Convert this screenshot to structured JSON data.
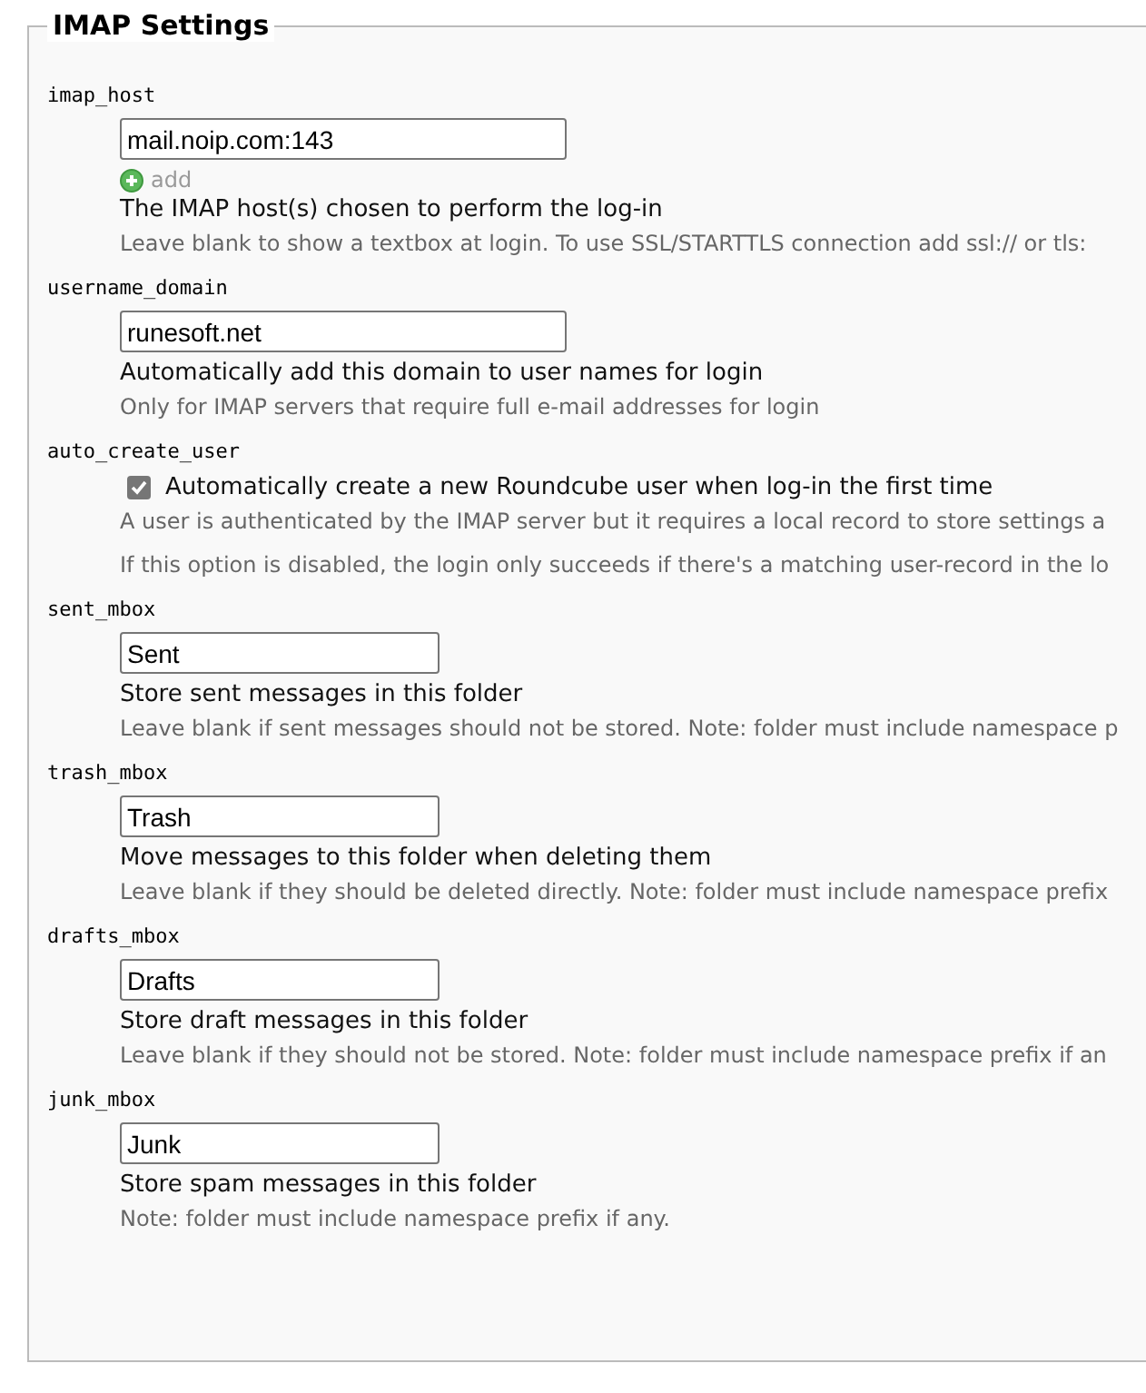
{
  "legend": "IMAP Settings",
  "settings": [
    {
      "name": "imap_host",
      "kind": "text",
      "value": "mail.noip.com:143",
      "wide": true,
      "add_link": "add",
      "title": "The IMAP host(s) chosen to perform the log-in",
      "hints": [
        "Leave blank to show a textbox at login. To use SSL/STARTTLS connection add ssl:// or tls:"
      ]
    },
    {
      "name": "username_domain",
      "kind": "text",
      "value": "runesoft.net",
      "wide": true,
      "title": "Automatically add this domain to user names for login",
      "hints": [
        "Only for IMAP servers that require full e-mail addresses for login"
      ]
    },
    {
      "name": "auto_create_user",
      "kind": "checkbox",
      "checked": true,
      "title": "Automatically create a new Roundcube user when log-in the first time",
      "hints": [
        "A user is authenticated by the IMAP server but it requires a local record to store settings a",
        "If this option is disabled, the login only succeeds if there's a matching user-record in the lo"
      ]
    },
    {
      "name": "sent_mbox",
      "kind": "text",
      "value": "Sent",
      "wide": false,
      "title": "Store sent messages in this folder",
      "hints": [
        "Leave blank if sent messages should not be stored. Note: folder must include namespace p"
      ]
    },
    {
      "name": "trash_mbox",
      "kind": "text",
      "value": "Trash",
      "wide": false,
      "title": "Move messages to this folder when deleting them",
      "hints": [
        "Leave blank if they should be deleted directly. Note: folder must include namespace prefix"
      ]
    },
    {
      "name": "drafts_mbox",
      "kind": "text",
      "value": "Drafts",
      "wide": false,
      "title": "Store draft messages in this folder",
      "hints": [
        "Leave blank if they should not be stored. Note: folder must include namespace prefix if an"
      ]
    },
    {
      "name": "junk_mbox",
      "kind": "text",
      "value": "Junk",
      "wide": false,
      "title": "Store spam messages in this folder",
      "hints": [
        "Note: folder must include namespace prefix if any."
      ]
    }
  ]
}
